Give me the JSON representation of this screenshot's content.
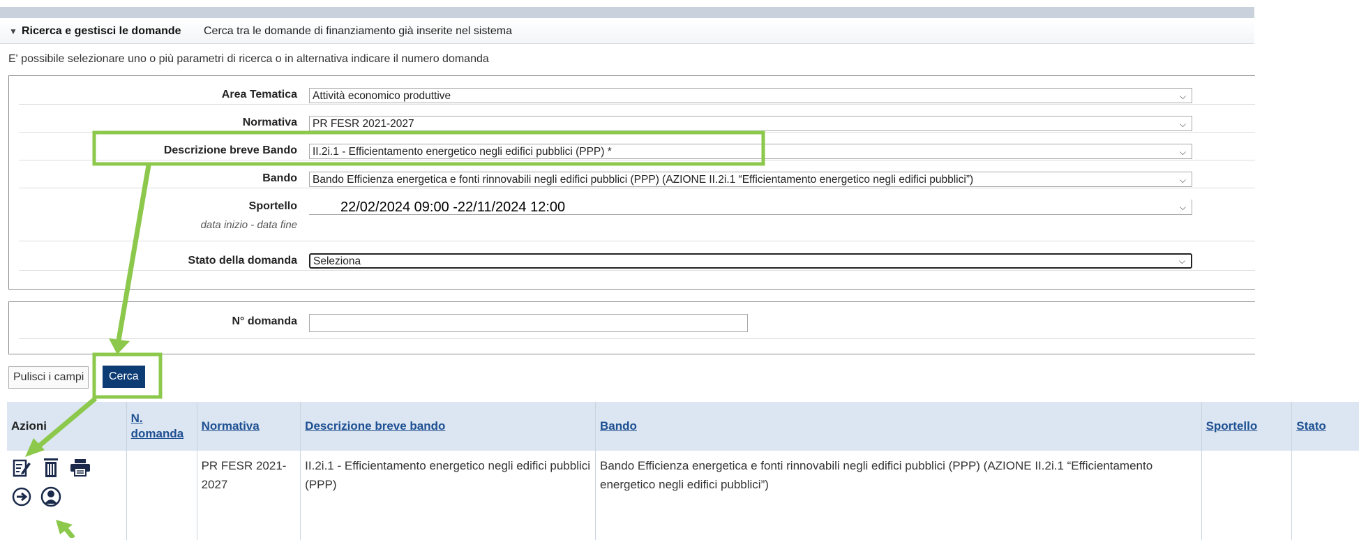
{
  "section": {
    "title": "Ricerca e gestisci le domande",
    "subtitle": "Cerca tra le domande di finanziamento già inserite nel sistema"
  },
  "intro": "E' possibile selezionare uno o più parametri di ricerca o in alternativa indicare il numero domanda",
  "form": {
    "area_tematica": {
      "label": "Area Tematica",
      "value": "Attività economico produttive"
    },
    "normativa": {
      "label": "Normativa",
      "value": "PR FESR 2021-2027"
    },
    "descrizione": {
      "label": "Descrizione breve Bando",
      "value": "II.2i.1 - Efficientamento energetico negli edifici pubblici (PPP) *"
    },
    "bando": {
      "label": "Bando",
      "value": "Bando Efficienza energetica e fonti rinnovabili negli edifici pubblici (PPP) (AZIONE II.2i.1 “Efficientamento energetico negli edifici pubblici”)"
    },
    "sportello": {
      "label": "Sportello",
      "sublabel": "data inizio - data fine",
      "value": "22/02/2024 09:00 -22/11/2024 12:00"
    },
    "stato": {
      "label": "Stato della domanda",
      "value": "Seleziona"
    },
    "numero": {
      "label": "N° domanda",
      "value": ""
    }
  },
  "buttons": {
    "pulisci": "Pulisci i campi",
    "cerca": "Cerca"
  },
  "table": {
    "headers": {
      "azioni": "Azioni",
      "n_domanda_1": "N.",
      "n_domanda_2": "domanda",
      "normativa": "Normativa",
      "descrizione": "Descrizione breve bando",
      "bando": "Bando",
      "sportello": "Sportello",
      "stato": "Stato"
    },
    "rows": [
      {
        "n_domanda": "",
        "normativa": "PR FESR 2021-2027",
        "descrizione": "II.2i.1 - Efficientamento energetico negli edifici pubblici (PPP)",
        "bando": "Bando Efficienza energetica e fonti rinnovabili negli edifici pubblici (PPP) (AZIONE II.2i.1 “Efficientamento energetico negli edifici pubblici”)",
        "sportello": "",
        "stato": ""
      }
    ],
    "row_icons": [
      "edit-icon",
      "trash-icon",
      "print-icon",
      "arrow-right-circle-icon",
      "user-circle-icon"
    ]
  },
  "colors": {
    "highlight": "#8cc84b",
    "button": "#0d3b74",
    "header_bg": "#dce6f2"
  }
}
